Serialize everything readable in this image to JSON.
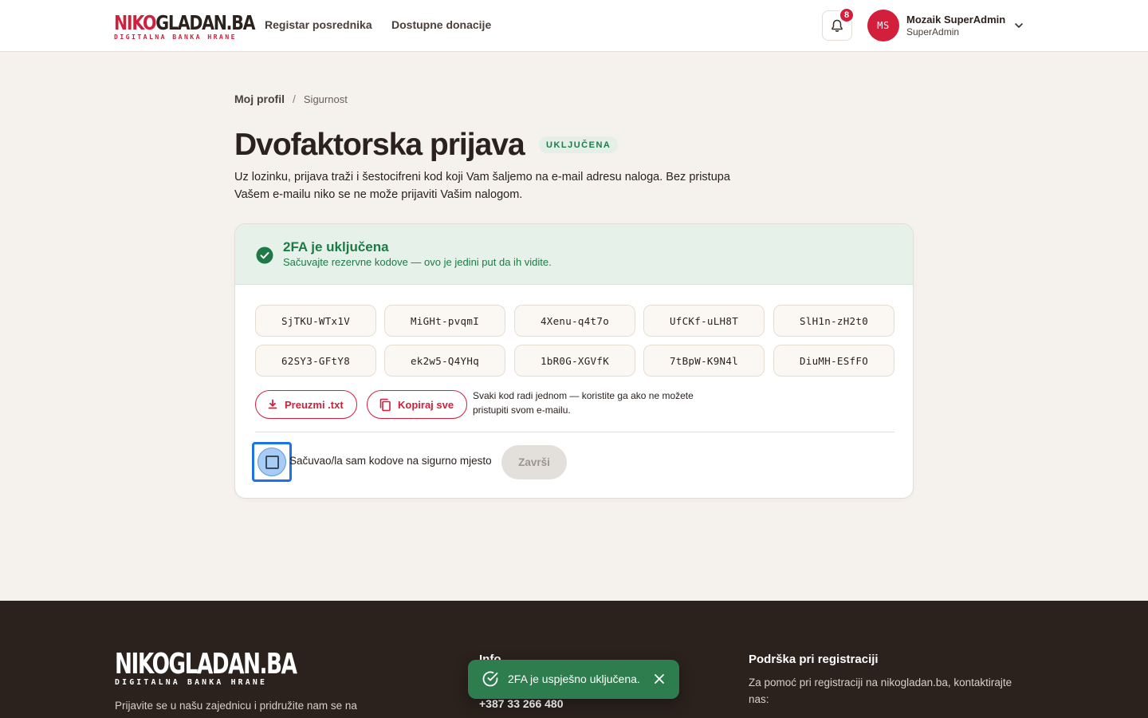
{
  "header": {
    "logo_main_red": "NIKO",
    "logo_main_dark": "GLADAN.BA",
    "logo_sub": "DIGITALNA BANKA HRANE",
    "nav": [
      "Registar posrednika",
      "Dostupne donacije"
    ],
    "notification_count": "8",
    "avatar_initials": "MS",
    "user_name": "Mozaik SuperAdmin",
    "user_role": "SuperAdmin"
  },
  "breadcrumb": {
    "parent": "Moj profil",
    "separator": "/",
    "current": "Sigurnost"
  },
  "page": {
    "title": "Dvofaktorska prijava",
    "status_badge": "UKLJUČENA",
    "description": "Uz lozinku, prijava traži i šestocifreni kod koji Vam šaljemo na e-mail adresu naloga. Bez pristupa Vašem e-mailu niko se ne može prijaviti Vašim nalogom."
  },
  "card": {
    "head_title": "2FA je uključena",
    "head_subtitle": "Sačuvajte rezervne kodove — ovo je jedini put da ih vidite.",
    "codes": [
      "SjTKU-WTx1V",
      "MiGHt-pvqmI",
      "4Xenu-q4t7o",
      "UfCKf-uLH8T",
      "SlH1n-zH2t0",
      "62SY3-GFtY8",
      "ek2w5-Q4YHq",
      "1bR0G-XGVfK",
      "7tBpW-K9N4l",
      "DiuMH-ESfFO"
    ],
    "download_label": "Preuzmi .txt",
    "copy_label": "Kopiraj sve",
    "hint": "Svaki kod radi jednom — koristite ga ako ne možete pristupiti svom e-mailu.",
    "checkbox_label": "Sačuvao/la sam kodove na sigurno mjesto",
    "checkbox_checked": false,
    "finish_label": "Završi"
  },
  "footer": {
    "logo_main": "NIKOGLADAN.BA",
    "logo_sub": "DIGITALNA BANKA HRANE",
    "about_text": "Prijavite se u našu zajednicu i pridružite nam se na",
    "info_title": "Info",
    "phone": "+387 33 266 480",
    "support_title": "Podrška pri registraciji",
    "support_text": "Za pomoć pri registraciji na nikogladan.ba, kontaktirajte nas:"
  },
  "toast": {
    "message": "2FA je uspješno uključena."
  },
  "colors": {
    "brand_red": "#d11f3c",
    "success_green": "#1e7a45",
    "toast_green": "#2e7d4f",
    "footer_bg": "#2b211d",
    "page_bg": "#f5f1ec"
  }
}
